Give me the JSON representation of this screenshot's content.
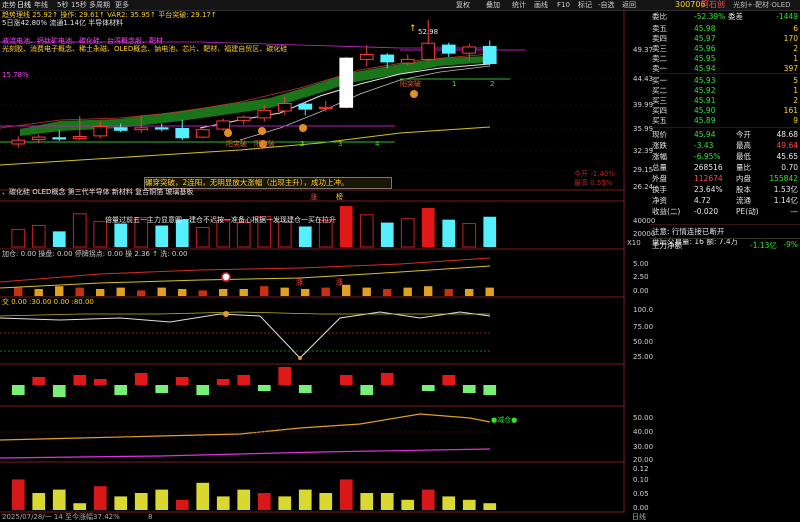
{
  "toolbar": {
    "tabs": [
      "走势",
      "日线",
      "年线",
      "5秒",
      "15秒",
      "多周期",
      "更多"
    ],
    "actions": [
      "复权",
      "叠加",
      "统计",
      "画线",
      "F10",
      "标记",
      "-自选",
      "返回"
    ]
  },
  "stock": {
    "code": "300706",
    "name": "阿石创",
    "tags": "光刻+·靶材·OLED"
  },
  "main_chart": {
    "indicator_line": "趋势理线 25.92↑  操作: 29.61↑  VAR2: 35.95↑  平台突破: 29.17↑",
    "sub_line": "5日涨42.80%  流通1.14亿  半导体材料",
    "concepts_1": "液流电池、钙钛矿电池、碳化硅、台湾概念股、靶材",
    "concepts_2": "光刻胶、消费电子概念、稀土永磁、OLED概念、钠电池、芯片、靶材、福建自贸区、碳化硅",
    "percent_marker": "15.78%",
    "high_label": "52.98",
    "price_axis": [
      "49.37",
      "44.43",
      "39.99",
      "35.99",
      "32.39",
      "29.15",
      "26.24"
    ],
    "red_axis_value": "53.90",
    "signal_labels": [
      "阳突破",
      "阳突破",
      "阳突破",
      "1",
      "2",
      "3",
      "4",
      "1",
      "2"
    ],
    "banner": "碾穿突破，2连阳，无明显放大涨幅（出现主升），成功上冲。",
    "right_mini": [
      "今开 -1.40%",
      "最高 0.55%"
    ],
    "concept_strip": "、碳化硅 OLED概念 第三代半导体 新材料 复合铜箔 玻璃基板",
    "marks": [
      "涨",
      "榜"
    ]
  },
  "volume_panel": {
    "label": "倍量过前五一主力显意图一建仓不迟按一准备心根据一发现建仓一买在拉升",
    "axis": [
      "40000",
      "20000"
    ],
    "unit": "X10"
  },
  "panel_a": {
    "legend": "加仓: 0.00   操盘: 0.00   停牌拐点: 0.00   操  2.36 ↑  洗: 0.00",
    "axis": [
      "5.00",
      "2.50",
      "0.00"
    ],
    "marks": [
      "涨",
      "涨"
    ]
  },
  "panel_b": {
    "legend": "交  0.00  :30.00  0.00  :80.00",
    "axis": [
      "100.0",
      "75.00",
      "50.00",
      "25.00"
    ]
  },
  "panel_d": {
    "axis": [
      "50.00",
      "40.00",
      "30.00",
      "20.00"
    ],
    "signal": "●减仓●"
  },
  "panel_e": {
    "axis": [
      "0.12",
      "0.10",
      "0.05",
      "0.00"
    ]
  },
  "bottom": {
    "date_note": "2025/07/28/一 14 至今涨幅37.42%",
    "scroll_num": "8",
    "week_btn": "日线"
  },
  "quote": {
    "header": [
      {
        "k": "委比",
        "v": "-52.39%",
        "k2": "委差",
        "v2": "-1449"
      }
    ],
    "asks": [
      {
        "label": "卖五",
        "price": "45.98",
        "vol": "6"
      },
      {
        "label": "卖四",
        "price": "45.97",
        "vol": "170"
      },
      {
        "label": "卖三",
        "price": "45.96",
        "vol": "2"
      },
      {
        "label": "卖二",
        "price": "45.95",
        "vol": "1"
      },
      {
        "label": "卖一",
        "price": "45.94",
        "vol": "397"
      }
    ],
    "bids": [
      {
        "label": "买一",
        "price": "45.93",
        "vol": "5"
      },
      {
        "label": "买二",
        "price": "45.92",
        "vol": "1"
      },
      {
        "label": "买三",
        "price": "45.91",
        "vol": "2"
      },
      {
        "label": "买四",
        "price": "45.90",
        "vol": "161"
      },
      {
        "label": "买五",
        "price": "45.89",
        "vol": "9"
      }
    ],
    "stats": [
      {
        "k": "现价",
        "v": "45.94",
        "k2": "今开",
        "v2": "48.68"
      },
      {
        "k": "涨跌",
        "v": "-3.43",
        "k2": "最高",
        "v2": "49.64"
      },
      {
        "k": "涨幅",
        "v": "-6.95%",
        "k2": "最低",
        "v2": "45.65"
      },
      {
        "k": "总量",
        "v": "268516",
        "k2": "量比",
        "v2": "0.70"
      },
      {
        "k": "外盘",
        "v": "112674",
        "k2": "内盘",
        "v2": "155842"
      },
      {
        "k": "换手",
        "v": "23.64%",
        "k2": "股本",
        "v2": "1.53亿"
      },
      {
        "k": "净资",
        "v": "4.72",
        "k2": "流通",
        "v2": "1.14亿"
      },
      {
        "k": "收益(二)",
        "v": "-0.020",
        "k2": "PE(动)",
        "v2": "—"
      }
    ],
    "notice": "注意: 行情连接已断开",
    "auction": "盘后交易量: 16  额: 7.4万",
    "flow_label": "主力净额",
    "flow_value": "-1.13亿",
    "flow_pct": "-9%"
  },
  "chart_data": {
    "type": "candlestick",
    "ohlc": [
      {
        "o": 33.0,
        "h": 34.2,
        "l": 32.4,
        "c": 33.6
      },
      {
        "o": 33.7,
        "h": 34.5,
        "l": 33.1,
        "c": 34.1
      },
      {
        "o": 34.0,
        "h": 35.2,
        "l": 33.5,
        "c": 33.8
      },
      {
        "o": 33.9,
        "h": 37.5,
        "l": 33.6,
        "c": 34.2
      },
      {
        "o": 34.3,
        "h": 36.6,
        "l": 33.9,
        "c": 35.8
      },
      {
        "o": 35.6,
        "h": 36.3,
        "l": 34.9,
        "c": 35.2
      },
      {
        "o": 35.3,
        "h": 37.6,
        "l": 34.8,
        "c": 35.6
      },
      {
        "o": 35.6,
        "h": 36.3,
        "l": 35.0,
        "c": 35.4
      },
      {
        "o": 35.5,
        "h": 36.9,
        "l": 33.6,
        "c": 34.0
      },
      {
        "o": 34.1,
        "h": 35.5,
        "l": 33.9,
        "c": 35.3
      },
      {
        "o": 35.4,
        "h": 37.1,
        "l": 35.1,
        "c": 36.7
      },
      {
        "o": 36.8,
        "h": 37.6,
        "l": 36.1,
        "c": 37.3
      },
      {
        "o": 37.2,
        "h": 39.3,
        "l": 36.6,
        "c": 38.4
      },
      {
        "o": 38.3,
        "h": 40.6,
        "l": 37.7,
        "c": 39.5
      },
      {
        "o": 39.4,
        "h": 39.6,
        "l": 37.6,
        "c": 38.6
      },
      {
        "o": 38.7,
        "h": 39.9,
        "l": 38.2,
        "c": 38.9
      },
      {
        "o": 38.9,
        "h": 47.0,
        "l": 38.7,
        "c": 46.8
      },
      {
        "o": 46.6,
        "h": 48.9,
        "l": 45.5,
        "c": 47.4
      },
      {
        "o": 47.3,
        "h": 47.6,
        "l": 45.2,
        "c": 46.2
      },
      {
        "o": 46.0,
        "h": 47.4,
        "l": 45.6,
        "c": 46.6
      },
      {
        "o": 46.6,
        "h": 52.98,
        "l": 46.3,
        "c": 49.2
      },
      {
        "o": 48.9,
        "h": 49.3,
        "l": 47.0,
        "c": 47.6
      },
      {
        "o": 47.6,
        "h": 49.1,
        "l": 46.3,
        "c": 48.6
      },
      {
        "o": 48.68,
        "h": 49.64,
        "l": 45.65,
        "c": 45.94
      }
    ],
    "volume": [
      18000,
      22000,
      16000,
      34000,
      26000,
      24000,
      30000,
      22000,
      28000,
      20000,
      27000,
      25000,
      31000,
      26000,
      21000,
      27000,
      42000,
      33000,
      25000,
      29000,
      40000,
      28000,
      24000,
      31000
    ],
    "yrange": [
      26.24,
      53.9
    ],
    "ylabel": ""
  }
}
